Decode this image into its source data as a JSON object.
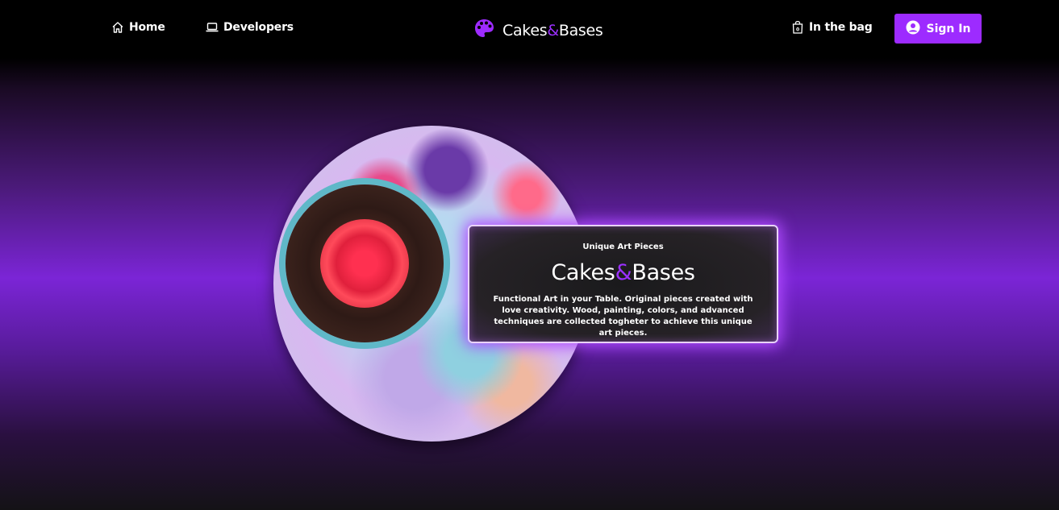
{
  "nav": {
    "home_label": "Home",
    "developers_label": "Developers",
    "bag_label": "In the bag",
    "signin_label": "Sign In"
  },
  "brand": {
    "part1": "Cakes",
    "amp": "&",
    "part2": "Bases"
  },
  "hero": {
    "kicker": "Unique Art Pieces",
    "title_part1": "Cakes",
    "title_amp": "&",
    "title_part2": "Bases",
    "description": "Functional Art in your Table. Original pieces created with love creativity. Wood, painting, colors, and advanced techniques are collected togheter to achieve this unique art pieces."
  },
  "colors": {
    "accent": "#9d2bff",
    "amp": "#9b30ff"
  },
  "icons": [
    "home-icon",
    "laptop-icon",
    "palette-icon",
    "shopping-bag-icon",
    "user-circle-icon"
  ]
}
